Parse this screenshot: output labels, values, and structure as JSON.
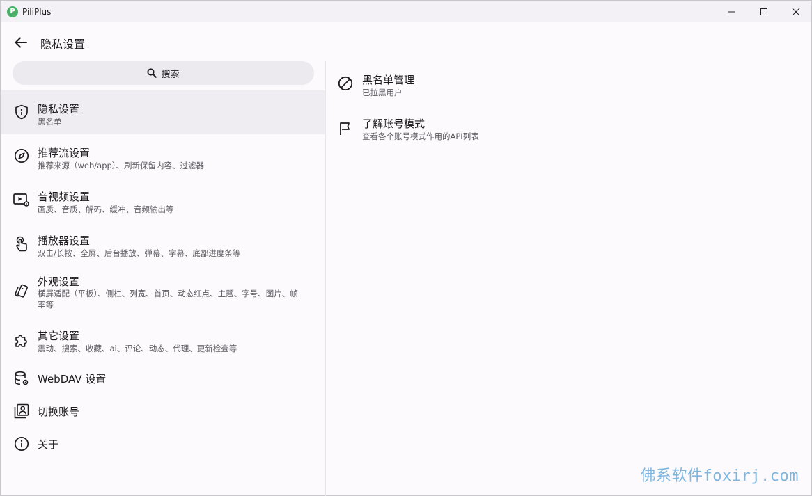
{
  "window": {
    "app_title": "PiliPlus",
    "logo_letter": "P"
  },
  "header": {
    "title": "隐私设置"
  },
  "search": {
    "label": "搜索"
  },
  "settings_list": [
    {
      "title": "隐私设置",
      "subtitle": "黑名单",
      "icon": "shield-icon",
      "active": true
    },
    {
      "title": "推荐流设置",
      "subtitle": "推荐来源（web/app）、刷新保留内容、过滤器",
      "icon": "compass-icon"
    },
    {
      "title": "音视频设置",
      "subtitle": "画质、音质、解码、缓冲、音频输出等",
      "icon": "video-settings-icon"
    },
    {
      "title": "播放器设置",
      "subtitle": "双击/长按、全屏、后台播放、弹幕、字幕、底部进度条等",
      "icon": "touch-icon"
    },
    {
      "title": "外观设置",
      "subtitle": "横屏适配（平板）、侧栏、列宽、首页、动态红点、主题、字号、图片、帧率等",
      "icon": "style-icon"
    },
    {
      "title": "其它设置",
      "subtitle": "震动、搜索、收藏、ai、评论、动态、代理、更新检查等",
      "icon": "extension-icon"
    },
    {
      "title": "WebDAV 设置",
      "subtitle": "",
      "icon": "database-settings-icon"
    },
    {
      "title": "切换账号",
      "subtitle": "",
      "icon": "account-box-icon"
    },
    {
      "title": "关于",
      "subtitle": "",
      "icon": "info-icon"
    }
  ],
  "detail_list": [
    {
      "title": "黑名单管理",
      "subtitle": "已拉黑用户",
      "icon": "block-icon"
    },
    {
      "title": "了解账号模式",
      "subtitle": "查看各个账号模式作用的API列表",
      "icon": "flag-icon"
    }
  ],
  "watermark": "佛系软件foxirj.com",
  "colors": {
    "accent": "#4caf6a",
    "active_bg": "#efedf1",
    "search_bg": "#eceaef"
  }
}
